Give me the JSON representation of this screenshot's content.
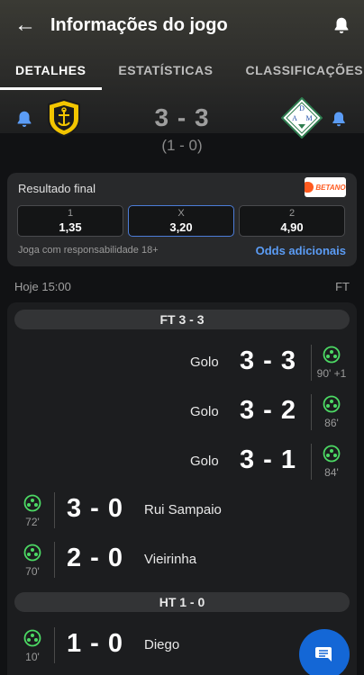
{
  "app_bar": {
    "title": "Informações do jogo"
  },
  "tabs": [
    {
      "label": "DETALHES",
      "active": true
    },
    {
      "label": "ESTATÍSTICAS",
      "active": false
    },
    {
      "label": "CLASSIFICAÇÕES",
      "active": false
    }
  ],
  "match": {
    "score": "3 - 3",
    "halftime": "(1 - 0)",
    "away_crest_letters": [
      "D",
      "A",
      "M"
    ]
  },
  "odds": {
    "title": "Resultado final",
    "bookmaker_logo_text": "BETANO",
    "options": [
      {
        "label": "1",
        "value": "1,35"
      },
      {
        "label": "X",
        "value": "3,20"
      },
      {
        "label": "2",
        "value": "4,90"
      }
    ],
    "disclaimer": "Joga com responsabilidade 18+",
    "more_link": "Odds adicionais"
  },
  "date_line": {
    "left": "Hoje 15:00",
    "right": "FT"
  },
  "events": {
    "ft_header": "FT 3 - 3",
    "ht_header": "HT 1 - 0",
    "away_goals": [
      {
        "label": "Golo",
        "score": "3 - 3",
        "minute": "90' +1"
      },
      {
        "label": "Golo",
        "score": "3 - 2",
        "minute": "86'"
      },
      {
        "label": "Golo",
        "score": "3 - 1",
        "minute": "84'"
      }
    ],
    "home_goals_2h": [
      {
        "player": "Rui Sampaio",
        "score": "3 - 0",
        "minute": "72'"
      },
      {
        "player": "Vieirinha",
        "score": "2 - 0",
        "minute": "70'"
      }
    ],
    "home_goals_1h": [
      {
        "player": "Diego",
        "score": "1 - 0",
        "minute": "10'"
      }
    ]
  },
  "colors": {
    "accent_blue": "#5b9cf5",
    "goal_green": "#4cd964",
    "fab_blue": "#1467d6"
  },
  "icons": [
    "back-arrow-icon",
    "bell-icon",
    "soccer-ball-icon",
    "chat-icon"
  ]
}
